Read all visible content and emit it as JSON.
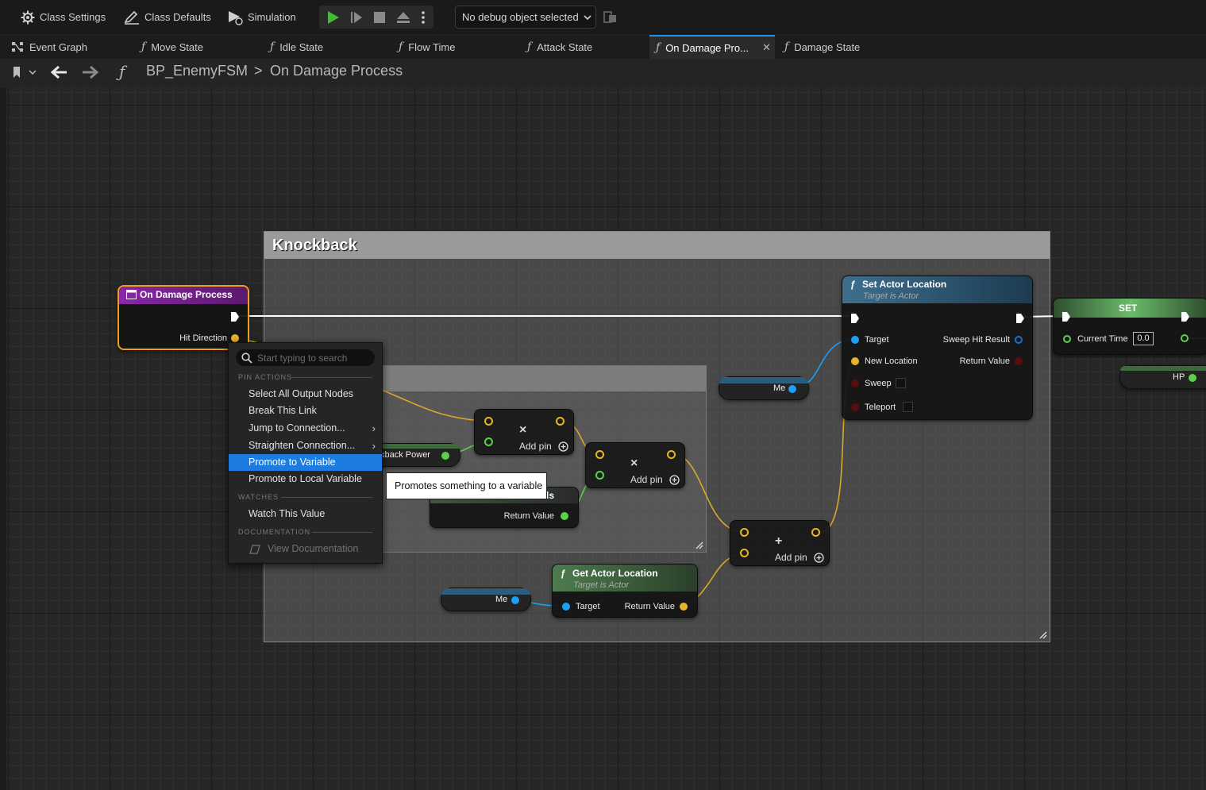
{
  "toolbar": {
    "class_settings": "Class Settings",
    "class_defaults": "Class Defaults",
    "simulation": "Simulation",
    "debug_object": "No debug object selected"
  },
  "tabs": [
    {
      "label": "Event Graph"
    },
    {
      "label": "Move State"
    },
    {
      "label": "Idle State"
    },
    {
      "label": "Flow Time"
    },
    {
      "label": "Attack State"
    },
    {
      "label": "On Damage Pro..."
    },
    {
      "label": "Damage State"
    }
  ],
  "breadcrumb": {
    "blueprint": "BP_EnemyFSM",
    "separator": ">",
    "function": "On Damage Process"
  },
  "graph": {
    "comment_title": "Knockback",
    "entry_node": {
      "title": "On Damage Process",
      "pin_hit_direction": "Hit Direction"
    },
    "set_actor_location": {
      "title": "Set Actor Location",
      "subtitle": "Target is Actor",
      "target": "Target",
      "new_location": "New Location",
      "sweep": "Sweep",
      "teleport": "Teleport",
      "sweep_hit_result": "Sweep Hit Result",
      "return_value": "Return Value"
    },
    "set_node": {
      "title": "SET",
      "current_time": "Current Time",
      "current_time_value": "0.0"
    },
    "hp_var": "HP",
    "me_var_top": "Me",
    "me_var_bottom": "Me",
    "knockback_power": "kback Power",
    "partial_node_title": "ls",
    "partial_return_value": "Return Value",
    "get_actor_location": {
      "title": "Get Actor Location",
      "subtitle": "Target is Actor",
      "target": "Target",
      "return_value": "Return Value"
    },
    "multiply_1": {
      "op": "×",
      "add_pin": "Add pin"
    },
    "multiply_2": {
      "op": "×",
      "add_pin": "Add pin"
    },
    "add_node": {
      "op": "+",
      "add_pin": "Add pin"
    }
  },
  "context_menu": {
    "search_placeholder": "Start typing to search",
    "sections": {
      "pin_actions": "PIN ACTIONS",
      "watches": "WATCHES",
      "documentation": "DOCUMENTATION"
    },
    "items": [
      {
        "label": "Select All Output Nodes"
      },
      {
        "label": "Break This Link"
      },
      {
        "label": "Jump to Connection..."
      },
      {
        "label": "Straighten Connection..."
      },
      {
        "label": "Promote to Variable"
      },
      {
        "label": "Promote to Local Variable"
      },
      {
        "label": "Watch This Value"
      },
      {
        "label": "View Documentation"
      }
    ]
  },
  "tooltip": "Promotes something to a variable",
  "colors": {
    "accent": "#1d7ce0",
    "exec": "#ffffff",
    "vector": "#e5b52c",
    "object": "#1aa1f5",
    "float": "#5bd14b",
    "bool": "#8a1010",
    "selected_outline": "#f0a020"
  }
}
